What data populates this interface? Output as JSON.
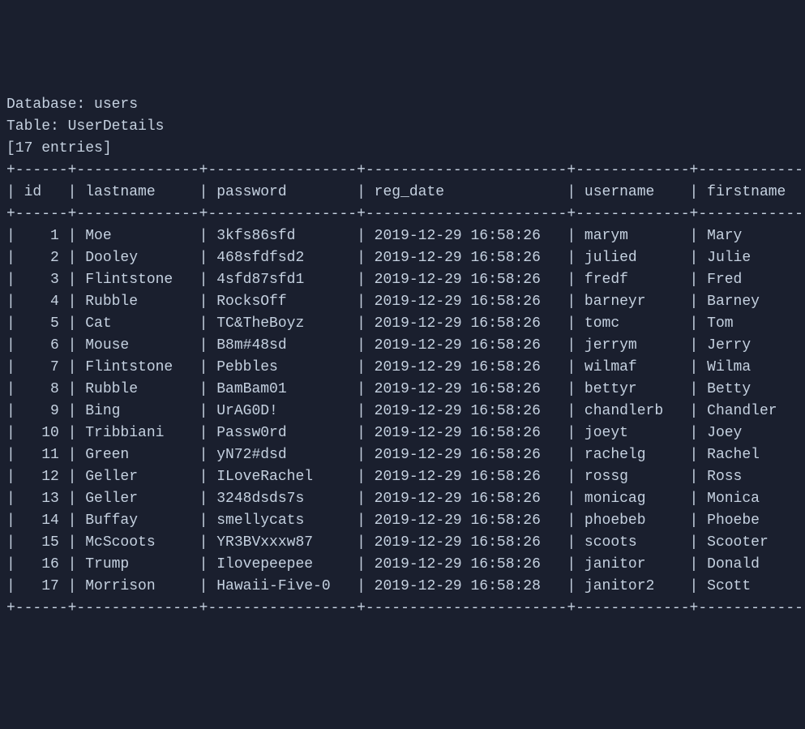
{
  "header": {
    "database_label": "Database:",
    "database_value": "users",
    "table_label": "Table:",
    "table_value": "UserDetails",
    "entries_text": "[17 entries]"
  },
  "columns": {
    "id": "id",
    "lastname": "lastname",
    "password": "password",
    "reg_date": "reg_date",
    "username": "username",
    "firstname": "firstname"
  },
  "rows": [
    {
      "id": "1",
      "lastname": "Moe",
      "password": "3kfs86sfd",
      "reg_date": "2019-12-29 16:58:26",
      "username": "marym",
      "firstname": "Mary"
    },
    {
      "id": "2",
      "lastname": "Dooley",
      "password": "468sfdfsd2",
      "reg_date": "2019-12-29 16:58:26",
      "username": "julied",
      "firstname": "Julie"
    },
    {
      "id": "3",
      "lastname": "Flintstone",
      "password": "4sfd87sfd1",
      "reg_date": "2019-12-29 16:58:26",
      "username": "fredf",
      "firstname": "Fred"
    },
    {
      "id": "4",
      "lastname": "Rubble",
      "password": "RocksOff",
      "reg_date": "2019-12-29 16:58:26",
      "username": "barneyr",
      "firstname": "Barney"
    },
    {
      "id": "5",
      "lastname": "Cat",
      "password": "TC&TheBoyz",
      "reg_date": "2019-12-29 16:58:26",
      "username": "tomc",
      "firstname": "Tom"
    },
    {
      "id": "6",
      "lastname": "Mouse",
      "password": "B8m#48sd",
      "reg_date": "2019-12-29 16:58:26",
      "username": "jerrym",
      "firstname": "Jerry"
    },
    {
      "id": "7",
      "lastname": "Flintstone",
      "password": "Pebbles",
      "reg_date": "2019-12-29 16:58:26",
      "username": "wilmaf",
      "firstname": "Wilma"
    },
    {
      "id": "8",
      "lastname": "Rubble",
      "password": "BamBam01",
      "reg_date": "2019-12-29 16:58:26",
      "username": "bettyr",
      "firstname": "Betty"
    },
    {
      "id": "9",
      "lastname": "Bing",
      "password": "UrAG0D!",
      "reg_date": "2019-12-29 16:58:26",
      "username": "chandlerb",
      "firstname": "Chandler"
    },
    {
      "id": "10",
      "lastname": "Tribbiani",
      "password": "Passw0rd",
      "reg_date": "2019-12-29 16:58:26",
      "username": "joeyt",
      "firstname": "Joey"
    },
    {
      "id": "11",
      "lastname": "Green",
      "password": "yN72#dsd",
      "reg_date": "2019-12-29 16:58:26",
      "username": "rachelg",
      "firstname": "Rachel"
    },
    {
      "id": "12",
      "lastname": "Geller",
      "password": "ILoveRachel",
      "reg_date": "2019-12-29 16:58:26",
      "username": "rossg",
      "firstname": "Ross"
    },
    {
      "id": "13",
      "lastname": "Geller",
      "password": "3248dsds7s",
      "reg_date": "2019-12-29 16:58:26",
      "username": "monicag",
      "firstname": "Monica"
    },
    {
      "id": "14",
      "lastname": "Buffay",
      "password": "smellycats",
      "reg_date": "2019-12-29 16:58:26",
      "username": "phoebeb",
      "firstname": "Phoebe"
    },
    {
      "id": "15",
      "lastname": "McScoots",
      "password": "YR3BVxxxw87",
      "reg_date": "2019-12-29 16:58:26",
      "username": "scoots",
      "firstname": "Scooter"
    },
    {
      "id": "16",
      "lastname": "Trump",
      "password": "Ilovepeepee",
      "reg_date": "2019-12-29 16:58:26",
      "username": "janitor",
      "firstname": "Donald"
    },
    {
      "id": "17",
      "lastname": "Morrison",
      "password": "Hawaii-Five-0",
      "reg_date": "2019-12-29 16:58:28",
      "username": "janitor2",
      "firstname": "Scott"
    }
  ],
  "widths": {
    "id": 4,
    "lastname": 12,
    "password": 15,
    "reg_date": 21,
    "username": 11,
    "firstname": 11
  }
}
